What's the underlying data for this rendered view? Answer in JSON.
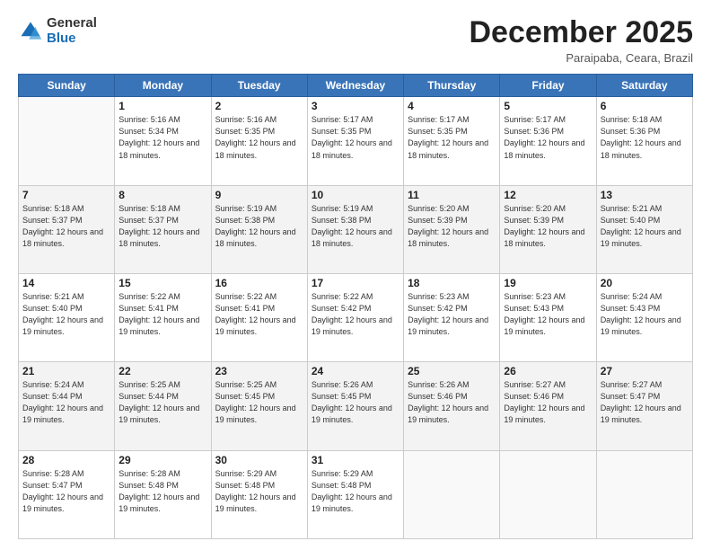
{
  "logo": {
    "general": "General",
    "blue": "Blue"
  },
  "header": {
    "month": "December 2025",
    "location": "Paraipaba, Ceara, Brazil"
  },
  "days_header": [
    "Sunday",
    "Monday",
    "Tuesday",
    "Wednesday",
    "Thursday",
    "Friday",
    "Saturday"
  ],
  "weeks": [
    [
      {
        "day": "",
        "sunrise": "",
        "sunset": "",
        "daylight": ""
      },
      {
        "day": "1",
        "sunrise": "Sunrise: 5:16 AM",
        "sunset": "Sunset: 5:34 PM",
        "daylight": "Daylight: 12 hours and 18 minutes."
      },
      {
        "day": "2",
        "sunrise": "Sunrise: 5:16 AM",
        "sunset": "Sunset: 5:35 PM",
        "daylight": "Daylight: 12 hours and 18 minutes."
      },
      {
        "day": "3",
        "sunrise": "Sunrise: 5:17 AM",
        "sunset": "Sunset: 5:35 PM",
        "daylight": "Daylight: 12 hours and 18 minutes."
      },
      {
        "day": "4",
        "sunrise": "Sunrise: 5:17 AM",
        "sunset": "Sunset: 5:35 PM",
        "daylight": "Daylight: 12 hours and 18 minutes."
      },
      {
        "day": "5",
        "sunrise": "Sunrise: 5:17 AM",
        "sunset": "Sunset: 5:36 PM",
        "daylight": "Daylight: 12 hours and 18 minutes."
      },
      {
        "day": "6",
        "sunrise": "Sunrise: 5:18 AM",
        "sunset": "Sunset: 5:36 PM",
        "daylight": "Daylight: 12 hours and 18 minutes."
      }
    ],
    [
      {
        "day": "7",
        "sunrise": "Sunrise: 5:18 AM",
        "sunset": "Sunset: 5:37 PM",
        "daylight": "Daylight: 12 hours and 18 minutes."
      },
      {
        "day": "8",
        "sunrise": "Sunrise: 5:18 AM",
        "sunset": "Sunset: 5:37 PM",
        "daylight": "Daylight: 12 hours and 18 minutes."
      },
      {
        "day": "9",
        "sunrise": "Sunrise: 5:19 AM",
        "sunset": "Sunset: 5:38 PM",
        "daylight": "Daylight: 12 hours and 18 minutes."
      },
      {
        "day": "10",
        "sunrise": "Sunrise: 5:19 AM",
        "sunset": "Sunset: 5:38 PM",
        "daylight": "Daylight: 12 hours and 18 minutes."
      },
      {
        "day": "11",
        "sunrise": "Sunrise: 5:20 AM",
        "sunset": "Sunset: 5:39 PM",
        "daylight": "Daylight: 12 hours and 18 minutes."
      },
      {
        "day": "12",
        "sunrise": "Sunrise: 5:20 AM",
        "sunset": "Sunset: 5:39 PM",
        "daylight": "Daylight: 12 hours and 18 minutes."
      },
      {
        "day": "13",
        "sunrise": "Sunrise: 5:21 AM",
        "sunset": "Sunset: 5:40 PM",
        "daylight": "Daylight: 12 hours and 19 minutes."
      }
    ],
    [
      {
        "day": "14",
        "sunrise": "Sunrise: 5:21 AM",
        "sunset": "Sunset: 5:40 PM",
        "daylight": "Daylight: 12 hours and 19 minutes."
      },
      {
        "day": "15",
        "sunrise": "Sunrise: 5:22 AM",
        "sunset": "Sunset: 5:41 PM",
        "daylight": "Daylight: 12 hours and 19 minutes."
      },
      {
        "day": "16",
        "sunrise": "Sunrise: 5:22 AM",
        "sunset": "Sunset: 5:41 PM",
        "daylight": "Daylight: 12 hours and 19 minutes."
      },
      {
        "day": "17",
        "sunrise": "Sunrise: 5:22 AM",
        "sunset": "Sunset: 5:42 PM",
        "daylight": "Daylight: 12 hours and 19 minutes."
      },
      {
        "day": "18",
        "sunrise": "Sunrise: 5:23 AM",
        "sunset": "Sunset: 5:42 PM",
        "daylight": "Daylight: 12 hours and 19 minutes."
      },
      {
        "day": "19",
        "sunrise": "Sunrise: 5:23 AM",
        "sunset": "Sunset: 5:43 PM",
        "daylight": "Daylight: 12 hours and 19 minutes."
      },
      {
        "day": "20",
        "sunrise": "Sunrise: 5:24 AM",
        "sunset": "Sunset: 5:43 PM",
        "daylight": "Daylight: 12 hours and 19 minutes."
      }
    ],
    [
      {
        "day": "21",
        "sunrise": "Sunrise: 5:24 AM",
        "sunset": "Sunset: 5:44 PM",
        "daylight": "Daylight: 12 hours and 19 minutes."
      },
      {
        "day": "22",
        "sunrise": "Sunrise: 5:25 AM",
        "sunset": "Sunset: 5:44 PM",
        "daylight": "Daylight: 12 hours and 19 minutes."
      },
      {
        "day": "23",
        "sunrise": "Sunrise: 5:25 AM",
        "sunset": "Sunset: 5:45 PM",
        "daylight": "Daylight: 12 hours and 19 minutes."
      },
      {
        "day": "24",
        "sunrise": "Sunrise: 5:26 AM",
        "sunset": "Sunset: 5:45 PM",
        "daylight": "Daylight: 12 hours and 19 minutes."
      },
      {
        "day": "25",
        "sunrise": "Sunrise: 5:26 AM",
        "sunset": "Sunset: 5:46 PM",
        "daylight": "Daylight: 12 hours and 19 minutes."
      },
      {
        "day": "26",
        "sunrise": "Sunrise: 5:27 AM",
        "sunset": "Sunset: 5:46 PM",
        "daylight": "Daylight: 12 hours and 19 minutes."
      },
      {
        "day": "27",
        "sunrise": "Sunrise: 5:27 AM",
        "sunset": "Sunset: 5:47 PM",
        "daylight": "Daylight: 12 hours and 19 minutes."
      }
    ],
    [
      {
        "day": "28",
        "sunrise": "Sunrise: 5:28 AM",
        "sunset": "Sunset: 5:47 PM",
        "daylight": "Daylight: 12 hours and 19 minutes."
      },
      {
        "day": "29",
        "sunrise": "Sunrise: 5:28 AM",
        "sunset": "Sunset: 5:48 PM",
        "daylight": "Daylight: 12 hours and 19 minutes."
      },
      {
        "day": "30",
        "sunrise": "Sunrise: 5:29 AM",
        "sunset": "Sunset: 5:48 PM",
        "daylight": "Daylight: 12 hours and 19 minutes."
      },
      {
        "day": "31",
        "sunrise": "Sunrise: 5:29 AM",
        "sunset": "Sunset: 5:48 PM",
        "daylight": "Daylight: 12 hours and 19 minutes."
      },
      {
        "day": "",
        "sunrise": "",
        "sunset": "",
        "daylight": ""
      },
      {
        "day": "",
        "sunrise": "",
        "sunset": "",
        "daylight": ""
      },
      {
        "day": "",
        "sunrise": "",
        "sunset": "",
        "daylight": ""
      }
    ]
  ]
}
